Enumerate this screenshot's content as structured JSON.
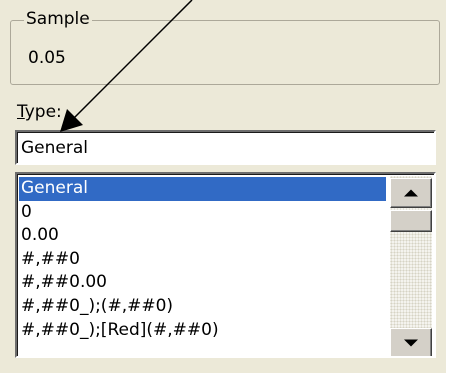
{
  "sample": {
    "legend": "Sample",
    "value": "0.05"
  },
  "type_section": {
    "label_first": "T",
    "label_rest": "ype:",
    "input_value": "General"
  },
  "format_list": {
    "items": [
      "General",
      "0",
      "0.00",
      "#,##0",
      "#,##0.00",
      "#,##0_);(#,##0)",
      "#,##0_);[Red](#,##0)"
    ],
    "selected_index": 0
  },
  "colors": {
    "dialog_face": "#ece9d8",
    "selection": "#316ac5"
  }
}
